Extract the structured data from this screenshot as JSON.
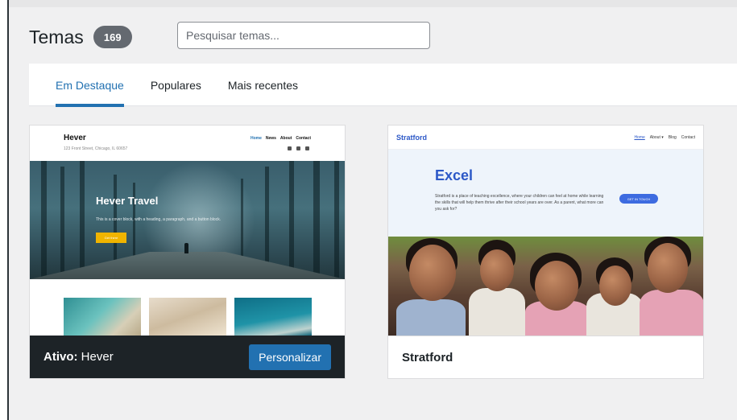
{
  "page": {
    "title": "Temas",
    "count": "169",
    "search_placeholder": "Pesquisar temas..."
  },
  "tabs": [
    {
      "label": "Em Destaque",
      "active": true
    },
    {
      "label": "Populares",
      "active": false
    },
    {
      "label": "Mais recentes",
      "active": false
    }
  ],
  "themes": [
    {
      "name": "Hever",
      "active_prefix": "Ativo:",
      "customize_label": "Personalizar",
      "preview": {
        "brand": "Hever",
        "address": "123 Front Street, Chicago, IL 60657",
        "nav": [
          "Home",
          "News",
          "About",
          "Contact"
        ],
        "hero_title": "Hever Travel",
        "hero_text": "This is a cover block, with a heading, a paragraph, and a button block.",
        "hero_button": "Get there"
      }
    },
    {
      "name": "Stratford",
      "preview": {
        "brand": "Stratford",
        "nav": [
          "Home",
          "About ▾",
          "Blog",
          "Contact"
        ],
        "hero_title": "Excel",
        "hero_text": "Stratford is a place of teaching excellence, where your children can feel at home while learning the skills that will help them thrive after their school years are over. As a parent, what more can you ask for?",
        "hero_button": "GET IN TOUCH"
      }
    }
  ],
  "colors": {
    "accent": "#2271b1",
    "active_bar": "#1d2327",
    "badge": "#646970",
    "background": "#f0f0f1"
  }
}
